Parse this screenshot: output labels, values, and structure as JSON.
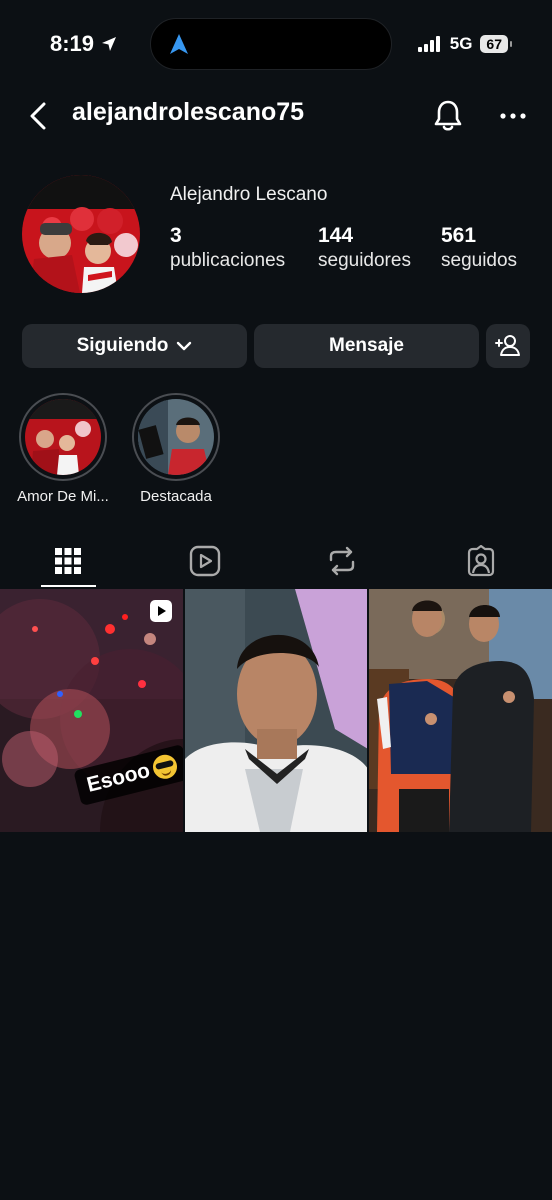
{
  "status_bar": {
    "time": "8:19",
    "network": "5G",
    "battery": "67"
  },
  "header": {
    "username": "alejandrolescano75"
  },
  "profile": {
    "display_name": "Alejandro Lescano",
    "stats": [
      {
        "value": "3",
        "label": "publicaciones"
      },
      {
        "value": "144",
        "label": "seguidores"
      },
      {
        "value": "561",
        "label": "seguidos"
      }
    ]
  },
  "actions": {
    "following_label": "Siguiendo",
    "message_label": "Mensaje"
  },
  "highlights": [
    {
      "label": "Amor De Mi..."
    },
    {
      "label": "Destacada"
    }
  ],
  "tabs": [
    "grid-icon",
    "reels-icon",
    "reposts-icon",
    "tagged-icon"
  ],
  "posts": [
    {
      "type": "reel",
      "caption": "Esooo"
    },
    {
      "type": "photo"
    },
    {
      "type": "photo"
    }
  ],
  "colors": {
    "background": "#0c1014",
    "button": "#25292e",
    "accent_blue": "#3797f0"
  }
}
